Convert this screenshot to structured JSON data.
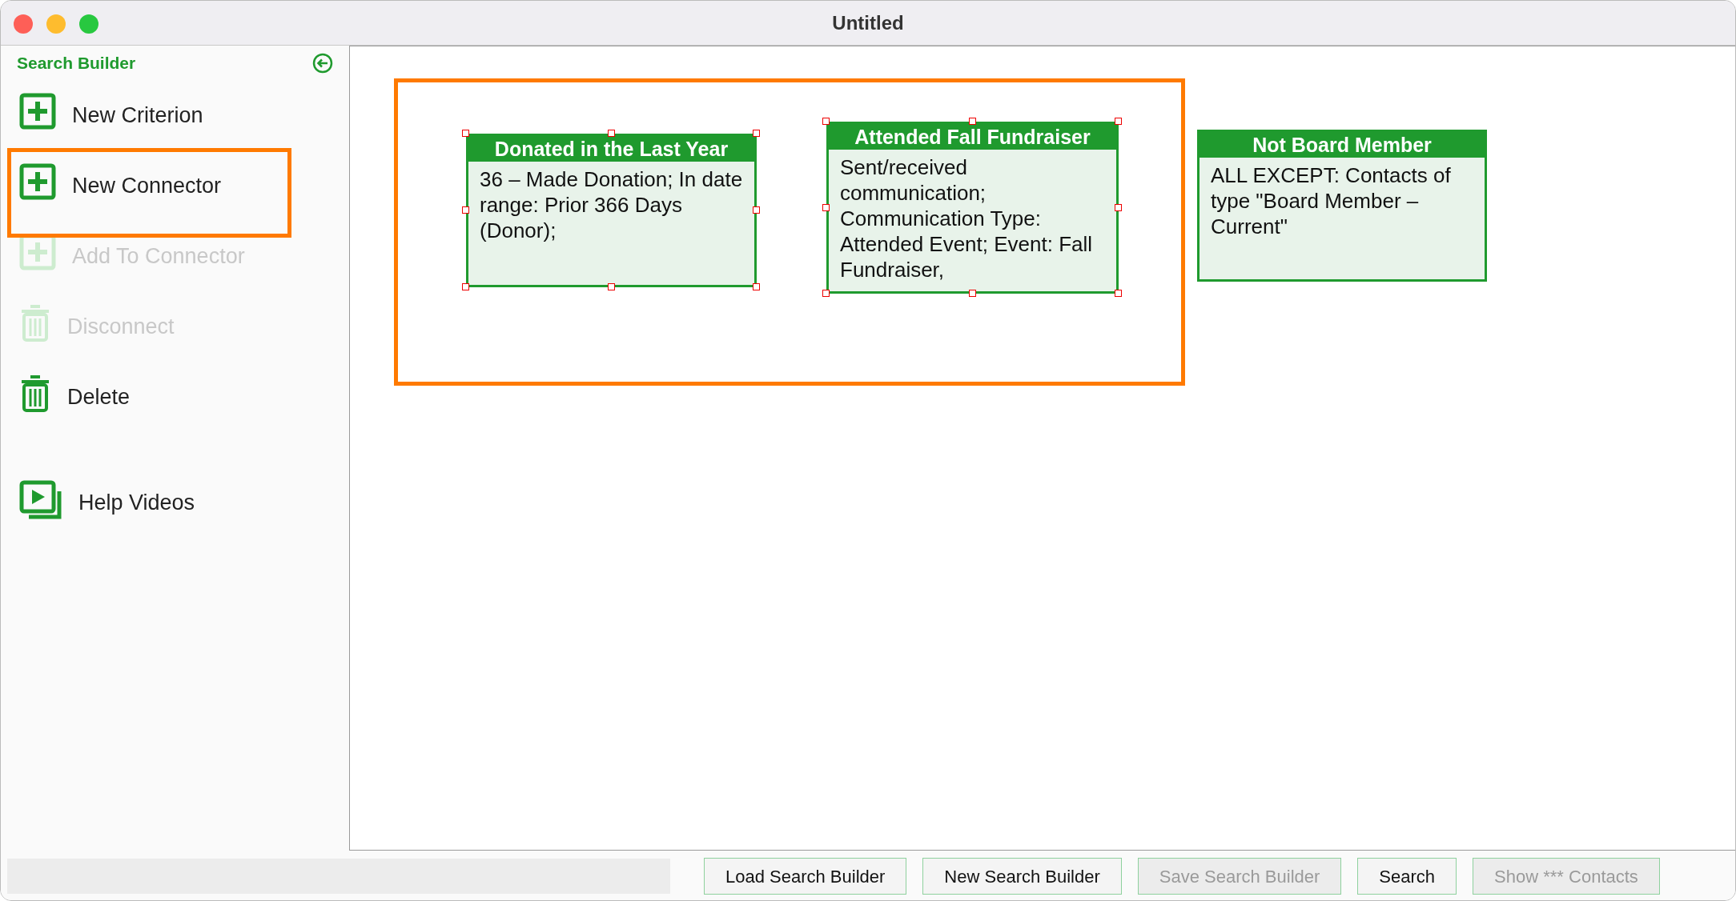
{
  "window": {
    "title": "Untitled"
  },
  "sidebar": {
    "title": "Search Builder",
    "items": [
      {
        "label": "New Criterion",
        "kind": "plus",
        "disabled": false,
        "highlighted": false
      },
      {
        "label": "New Connector",
        "kind": "plus",
        "disabled": false,
        "highlighted": true
      },
      {
        "label": "Add To Connector",
        "kind": "plus",
        "disabled": true,
        "highlighted": false
      },
      {
        "label": "Disconnect",
        "kind": "trash",
        "disabled": true,
        "highlighted": false
      },
      {
        "label": "Delete",
        "kind": "trash",
        "disabled": false,
        "highlighted": false
      },
      {
        "label": "Help Videos",
        "kind": "video",
        "disabled": false,
        "highlighted": false
      }
    ]
  },
  "canvas": {
    "highlight_frame": true,
    "nodes": [
      {
        "title": "Donated in the Last Year",
        "text": "36 – Made Donation; In date range: Prior 366 Days (Donor);",
        "selected": true
      },
      {
        "title": "Attended Fall Fundraiser",
        "text": "Sent/received communication; Communication Type: Attended Event; Event: Fall Fundraiser,",
        "selected": true
      },
      {
        "title": "Not Board Member",
        "text": "ALL EXCEPT: Contacts of type \"Board Member – Current\"",
        "selected": false
      }
    ]
  },
  "buttons": [
    {
      "label": "Load Search Builder",
      "disabled": false
    },
    {
      "label": "New Search Builder",
      "disabled": false
    },
    {
      "label": "Save Search Builder",
      "disabled": true
    },
    {
      "label": "Search",
      "disabled": false
    },
    {
      "label": "Show *** Contacts",
      "disabled": true
    }
  ]
}
